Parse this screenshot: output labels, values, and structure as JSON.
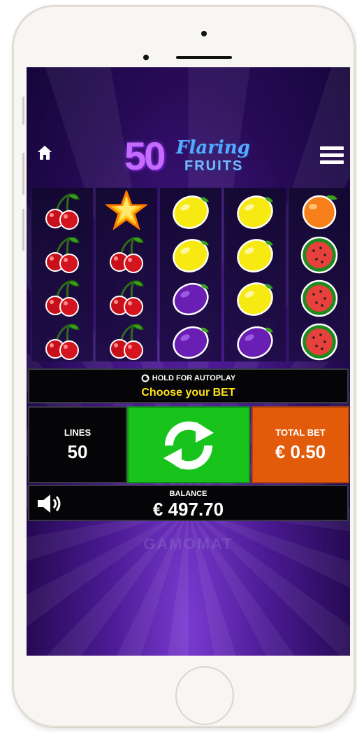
{
  "game": {
    "logo_number": "50",
    "logo_script": "Flaring",
    "logo_sub": "FRUITS",
    "watermark": "GAMOMAT"
  },
  "reels": [
    [
      "cherry",
      "cherry",
      "cherry",
      "cherry"
    ],
    [
      "star",
      "cherry",
      "cherry",
      "cherry"
    ],
    [
      "lemon",
      "lemon",
      "plum",
      "plum"
    ],
    [
      "lemon",
      "lemon",
      "lemon",
      "plum"
    ],
    [
      "orange",
      "watermelon",
      "watermelon",
      "watermelon"
    ]
  ],
  "controls": {
    "autoplay_hint": "HOLD FOR AUTOPLAY",
    "choose_bet": "Choose your BET",
    "lines_label": "LINES",
    "lines_value": "50",
    "total_bet_label": "TOTAL BET",
    "total_bet_value": "€ 0.50",
    "balance_label": "BALANCE",
    "balance_value": "€ 497.70"
  },
  "icons": [
    "home-icon",
    "menu-icon",
    "refresh-icon",
    "spin-icon",
    "sound-icon"
  ],
  "colors": {
    "spin_green": "#18c41c",
    "total_bet_orange": "#e25b0a",
    "choose_bet_yellow": "#ffe21a",
    "background_purple": "#4b1a93"
  }
}
